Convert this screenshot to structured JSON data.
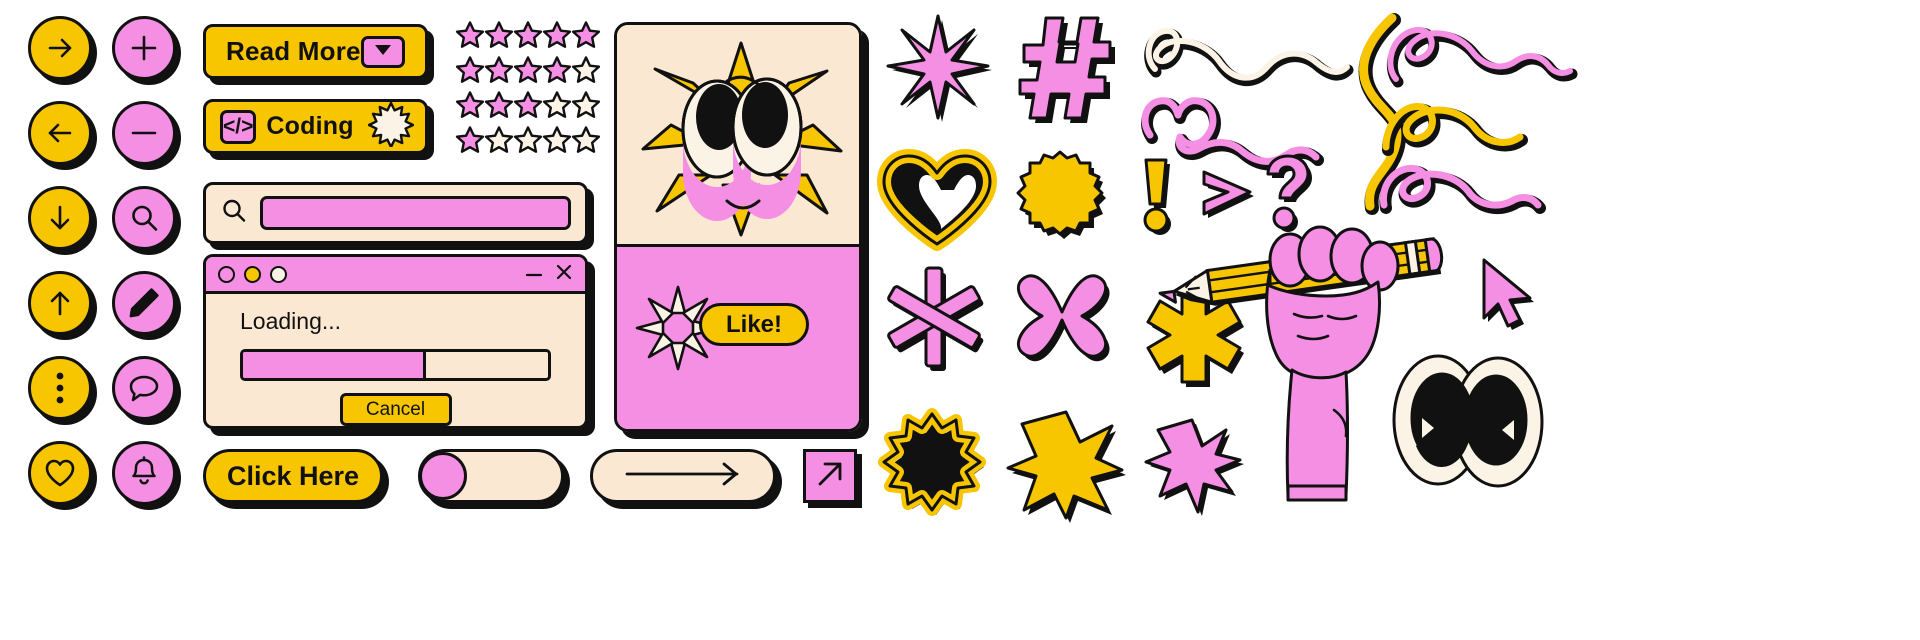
{
  "palette": {
    "yellow": "#F7C600",
    "pink": "#F48FE4",
    "cream": "#FBE8D3",
    "offwhite": "#FBF4E6",
    "ink": "#111111",
    "white": "#FFFFFF"
  },
  "icon_buttons": {
    "column_yellow": [
      {
        "name": "arrow-right-icon",
        "label": "Arrow right"
      },
      {
        "name": "arrow-left-icon",
        "label": "Arrow left"
      },
      {
        "name": "arrow-down-icon",
        "label": "Arrow down"
      },
      {
        "name": "arrow-up-icon",
        "label": "Arrow up"
      },
      {
        "name": "more-vertical-icon",
        "label": "More options"
      },
      {
        "name": "heart-outline-icon",
        "label": "Favorite"
      }
    ],
    "column_pink": [
      {
        "name": "plus-icon",
        "label": "Add"
      },
      {
        "name": "minus-icon",
        "label": "Remove"
      },
      {
        "name": "search-icon",
        "label": "Search"
      },
      {
        "name": "pencil-icon",
        "label": "Edit"
      },
      {
        "name": "chat-bubble-icon",
        "label": "Comment"
      },
      {
        "name": "bell-icon",
        "label": "Notifications"
      }
    ]
  },
  "buttons": {
    "read_more": {
      "label": "Read More",
      "dropdown_icon": "caret-down-icon"
    },
    "coding": {
      "label": "Coding",
      "code_glyph": "</>",
      "badge_icon": "starburst-icon"
    },
    "click_here": {
      "label": "Click Here"
    }
  },
  "search": {
    "icon": "search-icon",
    "value": "",
    "placeholder": ""
  },
  "rating": {
    "max": 5,
    "rows": [
      5,
      4,
      3,
      1
    ],
    "filled_color": "#F48FE4",
    "empty_color": "#FBF4E6"
  },
  "dialog": {
    "traffic_lights": [
      "close-dot",
      "minimize-dot",
      "maximize-dot"
    ],
    "controls": [
      "minimize-icon",
      "close-icon"
    ],
    "title": "Loading...",
    "progress_percent": 60,
    "cancel_label": "Cancel"
  },
  "card": {
    "character_icon": "sunburst-eyes-face",
    "like_label": "Like!",
    "sparkle_icon": "sparkle-burst-icon"
  },
  "toggle": {
    "state": "off",
    "knob_position": "left"
  },
  "pills": {
    "long_arrow_icon": "long-arrow-right-icon",
    "diagonal_arrow_icon": "arrow-up-right-icon"
  },
  "stickers": [
    {
      "name": "asterisk-star-pink",
      "color": "#F48FE4"
    },
    {
      "name": "hashtag-pink",
      "color": "#F48FE4"
    },
    {
      "name": "squiggle-loop-cream",
      "color": "#FBF4E6"
    },
    {
      "name": "squiggle-vertical-yellow",
      "color": "#F7C600"
    },
    {
      "name": "spiral-loop-pink",
      "color": "#F48FE4"
    },
    {
      "name": "heart-outline-yellow",
      "color": "#F7C600"
    },
    {
      "name": "scalloped-badge-yellow",
      "color": "#F7C600"
    },
    {
      "name": "heart-squiggle-pink",
      "color": "#F48FE4"
    },
    {
      "name": "loop-swirl-yellow",
      "color": "#F7C600"
    },
    {
      "name": "exclamation-yellow",
      "color": "#F7C600"
    },
    {
      "name": "chevron-right-pink",
      "color": "#F48FE4"
    },
    {
      "name": "question-mark-pink",
      "color": "#F48FE4"
    },
    {
      "name": "double-spiral-pink",
      "color": "#F48FE4"
    },
    {
      "name": "asterisk-six-pink",
      "color": "#F48FE4"
    },
    {
      "name": "cross-x-pink",
      "color": "#F48FE4"
    },
    {
      "name": "asterisk-six-yellow",
      "color": "#F7C600"
    },
    {
      "name": "pencil-icon-yellow",
      "color": "#F7C600"
    },
    {
      "name": "cursor-arrow-pink",
      "color": "#F48FE4"
    },
    {
      "name": "wavy-star-outline-yellow",
      "color": "#F7C600"
    },
    {
      "name": "burst-star-yellow",
      "color": "#F7C600"
    },
    {
      "name": "spiky-star-pink",
      "color": "#F48FE4"
    },
    {
      "name": "fist-hand-pink",
      "color": "#F48FE4"
    },
    {
      "name": "cartoon-eyes",
      "color": "#FBF4E6"
    }
  ]
}
